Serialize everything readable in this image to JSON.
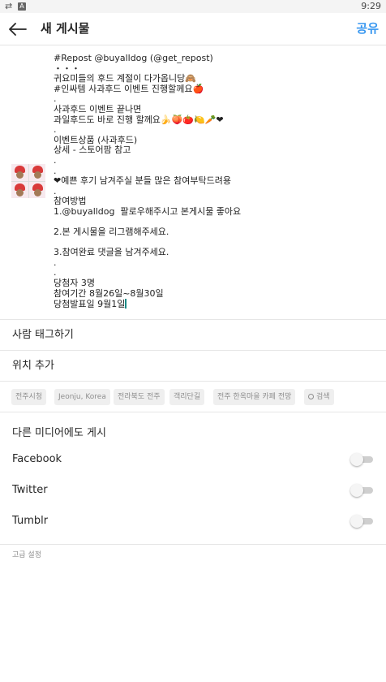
{
  "status_bar": {
    "time": "9:29",
    "icons": [
      "repeat-icon",
      "notification-a-icon"
    ]
  },
  "header": {
    "title": "새 게시물",
    "share_label": "공유",
    "back_icon": "arrow-left-icon"
  },
  "compose": {
    "thumbnail": "post-thumbnail",
    "caption_lines": [
      "#Repost @buyalldog (@get_repost)",
      "・・・",
      "귀요미들의 후드 계절이 다가옵니당🙈",
      "#인싸템 사과후드 이벤트 진행할께요🍎",
      ".",
      "사과후드 이벤트 끝나면",
      "과일후드도 바로 진행 할께요🍌🍑🍅🍋🥕❤",
      ".",
      "이벤트상품 (사과후드)",
      "상세 - 스토어팜 참고",
      ".",
      ".",
      "❤예쁜 후기 남겨주실 분들 많은 참여부탁드려용",
      ".",
      "참여방법",
      "1.@buyalldog  팔로우해주시고 본게시물 좋아요",
      "",
      "2.본 게시물을 리그램해주세요.",
      "",
      "3.참여완료 댓글을 남겨주세요.",
      ".",
      ".",
      "당첨자 3명",
      "참여기간 8월26일~8월30일",
      "당첨발표일 9월1일"
    ]
  },
  "tag_people_label": "사람 태그하기",
  "add_location_label": "위치 추가",
  "location_suggestions": [
    "전주시청",
    "Jeonju, Korea",
    "전라북도 전주",
    "객리단길",
    "전주 한옥마을 카페 전망",
    "검색"
  ],
  "share_other": {
    "title": "다른 미디어에도 게시",
    "items": [
      {
        "label": "Facebook",
        "enabled": false
      },
      {
        "label": "Twitter",
        "enabled": false
      },
      {
        "label": "Tumblr",
        "enabled": false
      }
    ]
  },
  "advanced_settings_label": "고급 설정",
  "colors": {
    "accent": "#3897f0",
    "caret": "#1b8a86",
    "chip_bg": "#efefef",
    "muted_text": "#8e8e8e"
  }
}
